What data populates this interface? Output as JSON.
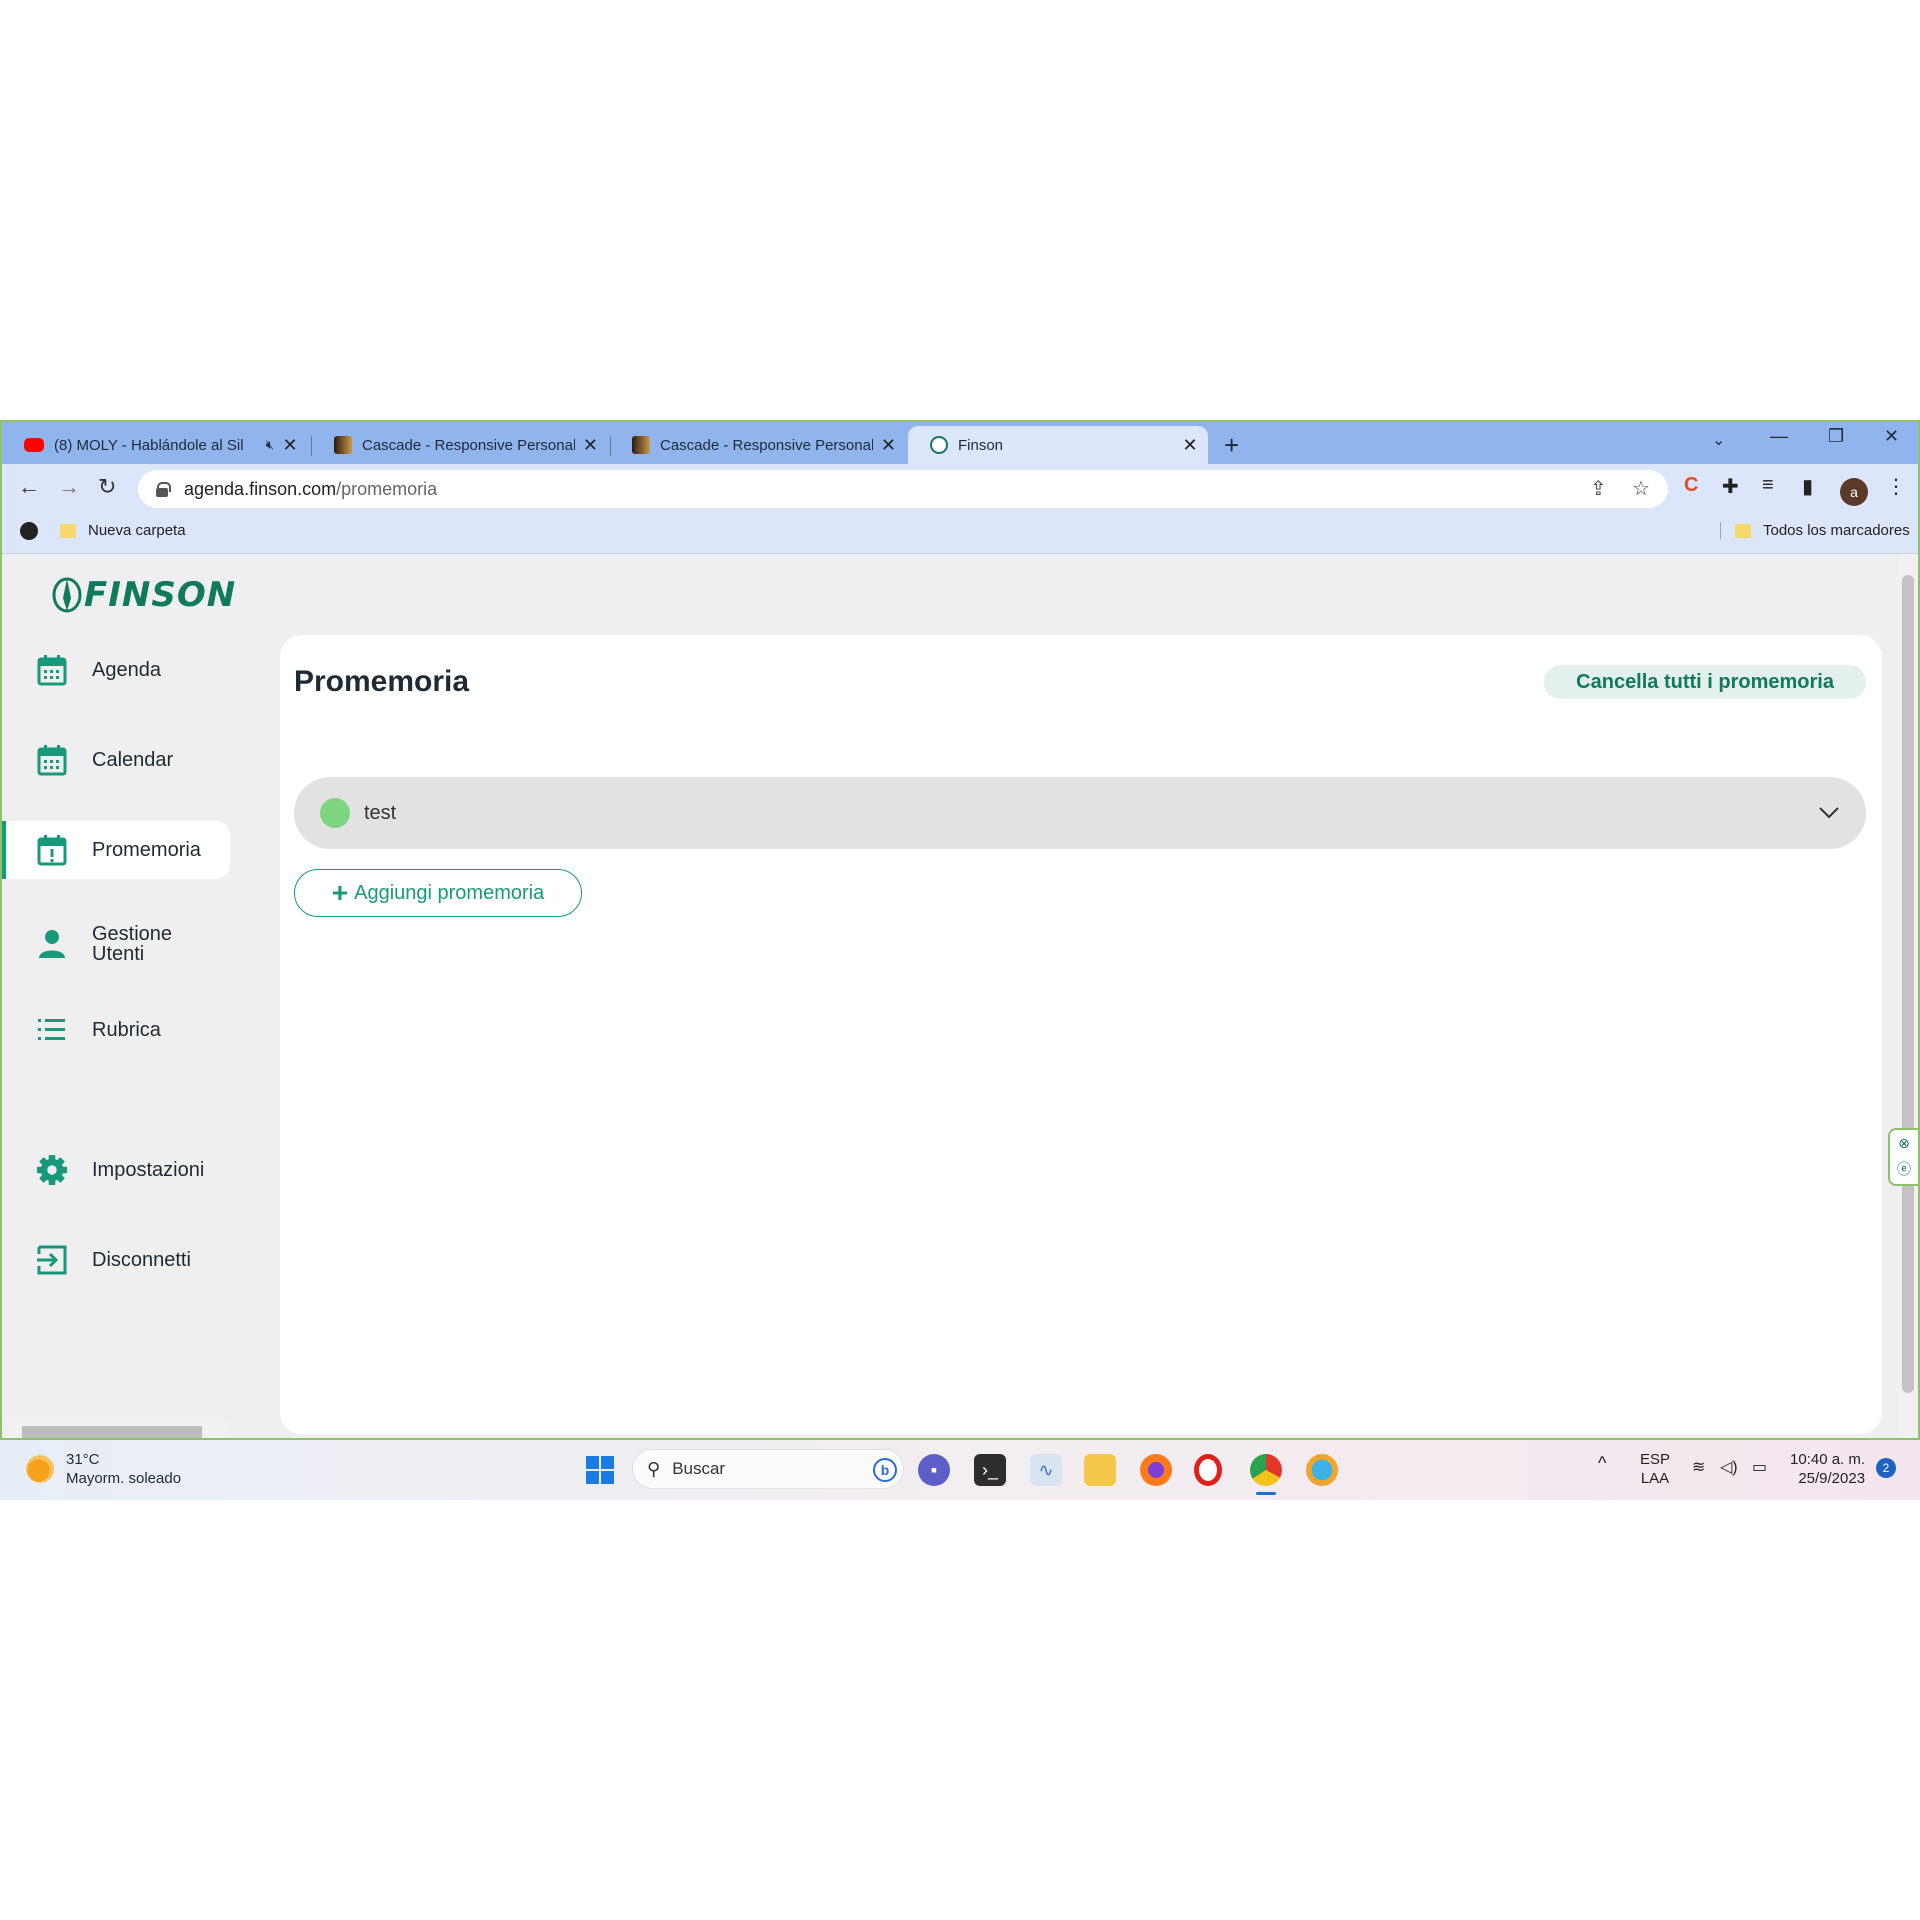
{
  "browser": {
    "tabs": [
      {
        "title": "(8) MOLY - Hablándole al Sil",
        "icon": "youtube-icon",
        "muted": true
      },
      {
        "title": "Cascade - Responsive Personal v",
        "icon": "cascade-icon"
      },
      {
        "title": "Cascade - Responsive Personal v",
        "icon": "cascade-icon"
      },
      {
        "title": "Finson",
        "icon": "finson-icon",
        "active": true
      }
    ],
    "url_domain": "agenda.finson.com",
    "url_path": "/promemoria",
    "profile_initial": "a",
    "bookmarks": {
      "folder": "Nueva carpeta",
      "all": "Todos los marcadores"
    }
  },
  "app": {
    "logo": "FINSON",
    "sidebar": [
      {
        "label": "Agenda",
        "icon": "calendar-icon"
      },
      {
        "label": "Calendar",
        "icon": "calendar-icon"
      },
      {
        "label": "Promemoria",
        "icon": "calendar-alert-icon",
        "active": true
      },
      {
        "label": "Gestione Utenti",
        "icon": "user-icon"
      },
      {
        "label": "Rubrica",
        "icon": "list-icon"
      },
      {
        "label": "Impostazioni",
        "icon": "gear-icon"
      },
      {
        "label": "Disconnetti",
        "icon": "logout-icon"
      }
    ],
    "main": {
      "title": "Promemoria",
      "clear_all": "Cancella tutti i promemoria",
      "reminders": [
        {
          "label": "test",
          "color": "#7dd57f"
        }
      ],
      "add_label": "Aggiungi promemoria"
    },
    "accent": "#17997a"
  },
  "taskbar": {
    "weather_temp": "31°C",
    "weather_desc": "Mayorm. soleado",
    "search_placeholder": "Buscar",
    "lang_top": "ESP",
    "lang_bottom": "LAA",
    "time": "10:40 a. m.",
    "date": "25/9/2023",
    "notifications": "2"
  }
}
